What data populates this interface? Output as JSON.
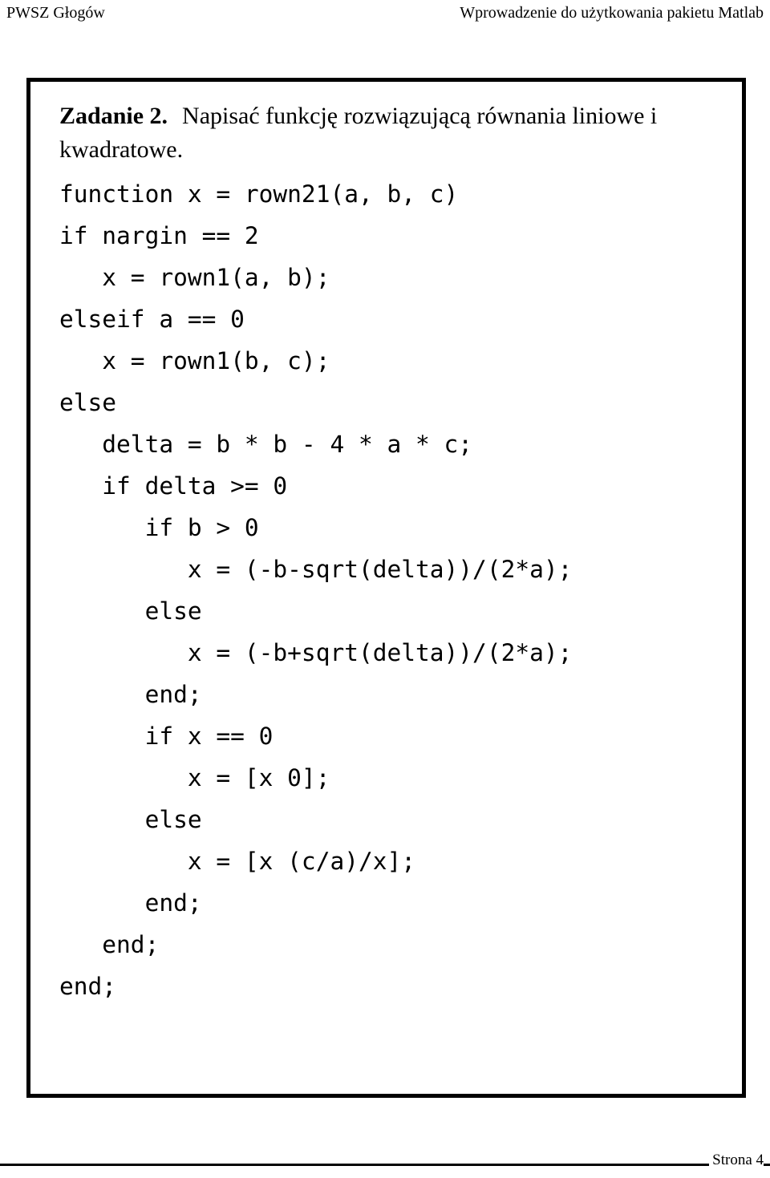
{
  "header": {
    "left": "PWSZ Głogów",
    "right": "Wprowadzenie do użytkowania pakietu Matlab"
  },
  "task": {
    "label": "Zadanie 2.",
    "text": "Napisać funkcję rozwiązującą równania liniowe i kwadratowe."
  },
  "code": {
    "language": "matlab",
    "lines": [
      "function x = rown21(a, b, c)",
      "if nargin == 2",
      "   x = rown1(a, b);",
      "elseif a == 0",
      "   x = rown1(b, c);",
      "else",
      "   delta = b * b - 4 * a * c;",
      "   if delta >= 0",
      "      if b > 0",
      "         x = (-b-sqrt(delta))/(2*a);",
      "      else",
      "         x = (-b+sqrt(delta))/(2*a);",
      "      end;",
      "      if x == 0",
      "         x = [x 0];",
      "      else",
      "         x = [x (c/a)/x];",
      "      end;",
      "   end;",
      "end;"
    ]
  },
  "footer": {
    "page_label": "Strona 4"
  },
  "colors": {
    "text": "#000000",
    "background": "#ffffff",
    "frame_border": "#000000"
  }
}
